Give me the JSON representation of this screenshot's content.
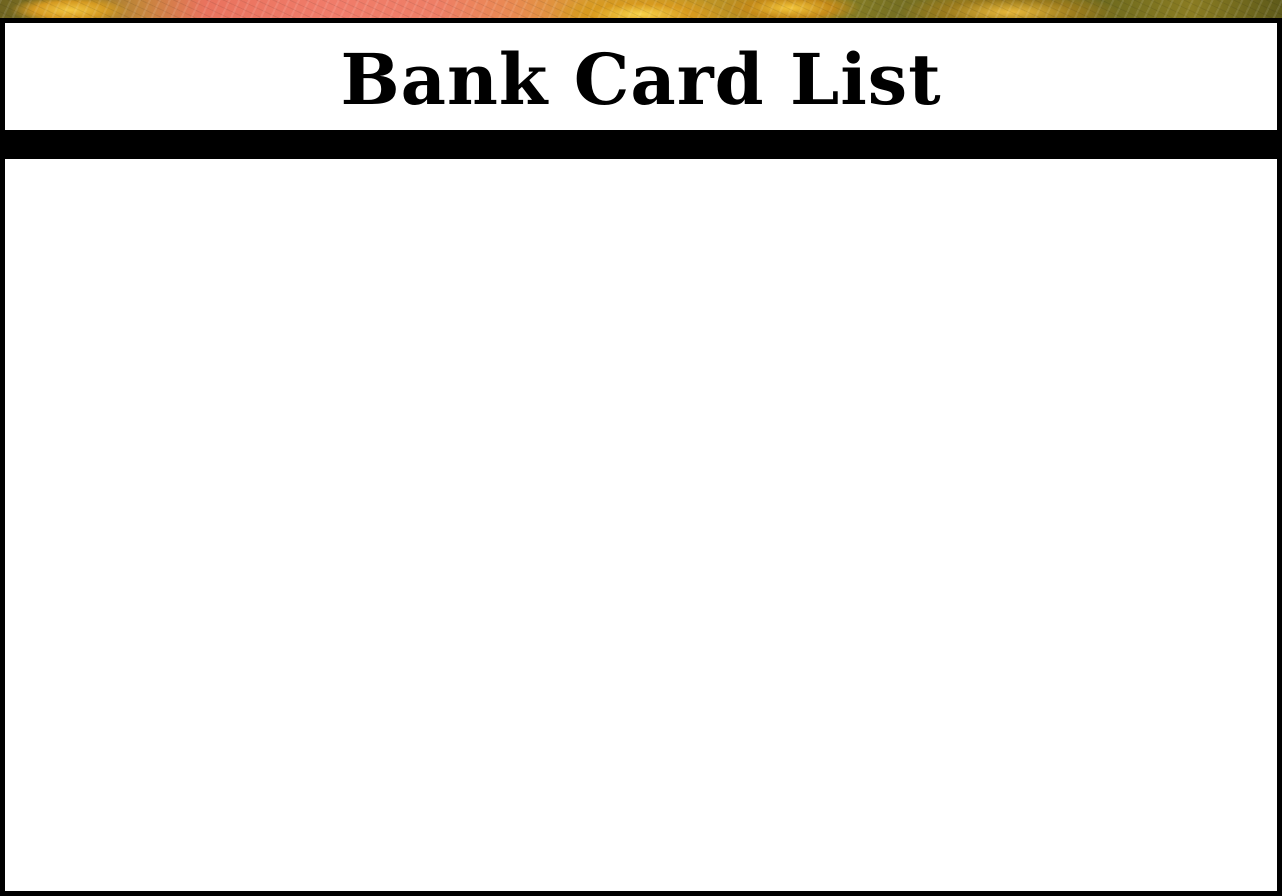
{
  "panel": {
    "title": "Bank Card List"
  },
  "card_list": {
    "items": []
  },
  "colors": {
    "panel_border": "#000000",
    "panel_background": "#ffffff",
    "title_text": "#000000",
    "backdrop_accent_coral": "#f07c6a",
    "backdrop_accent_gold": "#d89a1e",
    "backdrop_accent_olive": "#756f22"
  }
}
